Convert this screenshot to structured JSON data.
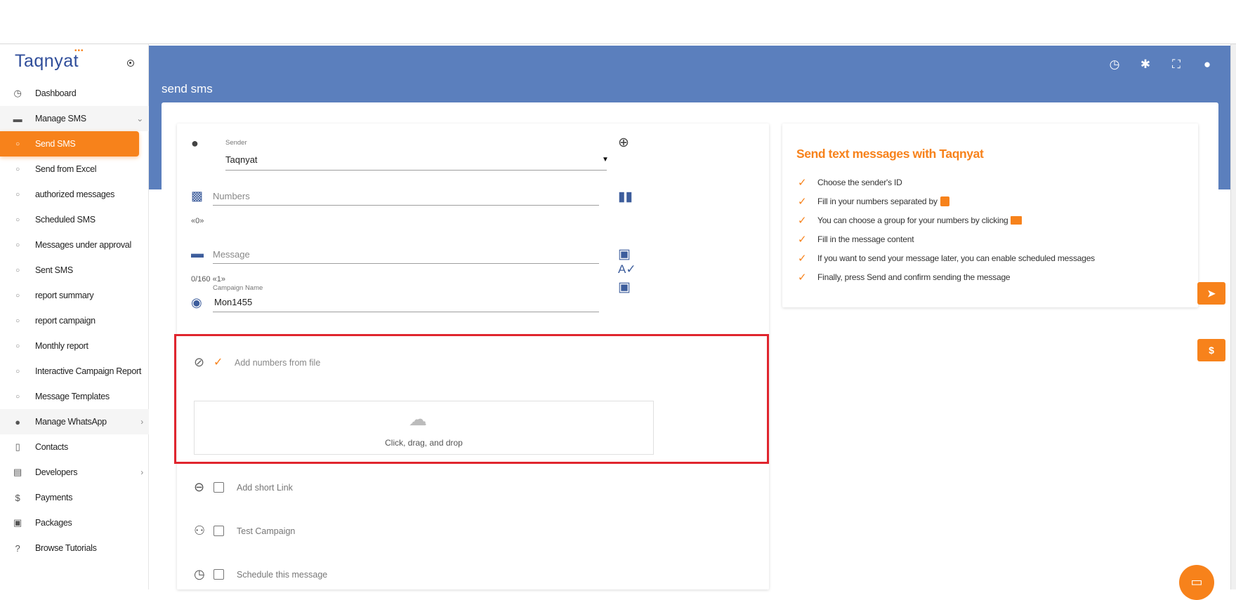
{
  "brand": {
    "logo": "Taqnyat",
    "accent": "#f7821b",
    "header_color": "#5b7fbd"
  },
  "header": {
    "title": "send sms",
    "icons": [
      "clock-icon",
      "uk-flag-icon",
      "fullscreen-icon",
      "account-icon"
    ]
  },
  "sidebar": {
    "items": [
      {
        "label": "Dashboard",
        "icon": "dashboard-icon"
      },
      {
        "label": "Manage SMS",
        "icon": "sms-icon"
      },
      {
        "label": "Send SMS",
        "icon": "circle-icon"
      },
      {
        "label": "Send from Excel",
        "icon": "circle-icon"
      },
      {
        "label": "authorized messages",
        "icon": "circle-icon"
      },
      {
        "label": "Scheduled SMS",
        "icon": "circle-icon"
      },
      {
        "label": "Messages under approval",
        "icon": "circle-icon"
      },
      {
        "label": "Sent SMS",
        "icon": "circle-icon"
      },
      {
        "label": "report summary",
        "icon": "circle-icon"
      },
      {
        "label": "report campaign",
        "icon": "circle-icon"
      },
      {
        "label": "Monthly report",
        "icon": "circle-icon"
      },
      {
        "label": "Interactive Campaign Report",
        "icon": "circle-icon"
      },
      {
        "label": "Message Templates",
        "icon": "circle-icon"
      },
      {
        "label": "Manage WhatsApp",
        "icon": "whatsapp-icon"
      },
      {
        "label": "Contacts",
        "icon": "contacts-book-icon"
      },
      {
        "label": "Developers",
        "icon": "developers-icon"
      },
      {
        "label": "Payments",
        "icon": "dollar-icon"
      },
      {
        "label": "Packages",
        "icon": "packages-icon"
      },
      {
        "label": "Browse Tutorials",
        "icon": "help-icon"
      }
    ]
  },
  "form": {
    "sender_label": "Sender",
    "sender_value": "Taqnyat",
    "numbers_placeholder": "Numbers",
    "numbers_count": "«0»",
    "message_placeholder": "Message",
    "message_counter": "0/160 «1»",
    "campaign_label": "Campaign Name",
    "campaign_value": "Mon1455",
    "file_label": "Add numbers from file",
    "drop_text": "Click, drag, and drop",
    "short_link_label": "Add short Link",
    "test_campaign_label": "Test Campaign",
    "schedule_label": "Schedule this message"
  },
  "info": {
    "title": "Send text messages with Taqnyat",
    "items": [
      "Choose the sender's ID",
      "Fill in your numbers separated by",
      "You can choose a group for your numbers by clicking",
      "Fill in the message content",
      "If you want to send your message later, you can enable scheduled messages",
      "Finally, press Send and confirm sending the message"
    ]
  },
  "floating": {
    "send_icon": "send-icon",
    "payment_symbol": "$",
    "chat_icon": "chat-icon"
  }
}
